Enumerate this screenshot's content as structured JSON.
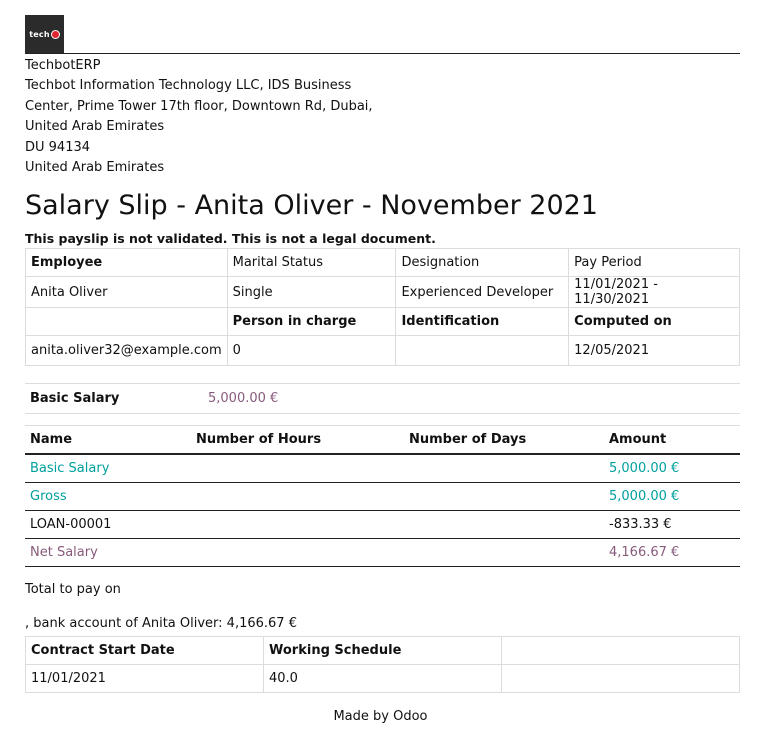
{
  "company": {
    "logo_text": "tech",
    "lines": [
      "TechbotERP",
      "Techbot Information Technology LLC, IDS Business",
      "Center, Prime Tower 17th floor, Downtown Rd, Dubai,",
      "United Arab Emirates",
      "DU 94134",
      "United Arab Emirates"
    ]
  },
  "title": "Salary Slip - Anita Oliver - November 2021",
  "warning": "This payslip is not validated. This is not a legal document.",
  "info": {
    "headers1": [
      "Employee",
      "Marital Status",
      "Designation",
      "Pay Period"
    ],
    "values1": [
      "Anita Oliver",
      "Single",
      "Experienced Developer",
      "11/01/2021 - 11/30/2021"
    ],
    "headers2": [
      "",
      "Person in charge",
      "Identification",
      "Computed on"
    ],
    "values2": [
      "anita.oliver32@example.com",
      "0",
      "",
      "12/05/2021"
    ]
  },
  "basic_salary": {
    "label": "Basic Salary",
    "value": "5,000.00 €"
  },
  "lines_table": {
    "headers": [
      "Name",
      "Number of Hours",
      "Number of Days",
      "Amount"
    ],
    "rows": [
      {
        "name": "Basic Salary",
        "hours": "",
        "days": "",
        "amount": "5,000.00 €",
        "style": "teal"
      },
      {
        "name": "Gross",
        "hours": "",
        "days": "",
        "amount": "5,000.00 €",
        "style": "teal"
      },
      {
        "name": "LOAN-00001",
        "hours": "",
        "days": "",
        "amount": "-833.33 €",
        "style": "plain"
      },
      {
        "name": "Net Salary",
        "hours": "",
        "days": "",
        "amount": "4,166.67 €",
        "style": "purple"
      }
    ]
  },
  "total_to_pay": "Total to pay on",
  "bank_line": ", bank account of Anita Oliver: 4,166.67 €",
  "contract": {
    "headers": [
      "Contract Start Date",
      "Working Schedule",
      ""
    ],
    "values": [
      "11/01/2021",
      "40.0",
      ""
    ]
  },
  "footer": "Made by Odoo",
  "colors": {
    "teal": "#00a09d",
    "purple": "#875a7b"
  }
}
